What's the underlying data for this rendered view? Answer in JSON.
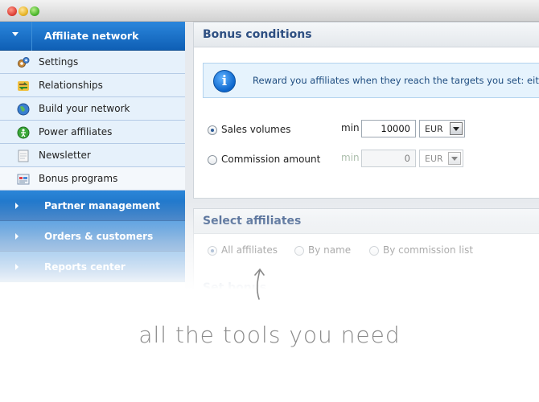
{
  "sidebar": {
    "header": {
      "label": "Affiliate network"
    },
    "items": [
      {
        "label": "Settings",
        "icon": "settings-icon"
      },
      {
        "label": "Relationships",
        "icon": "relationships-icon"
      },
      {
        "label": "Build your network",
        "icon": "globe-icon"
      },
      {
        "label": "Power affiliates",
        "icon": "power-affiliate-icon"
      },
      {
        "label": "Newsletter",
        "icon": "newsletter-icon"
      },
      {
        "label": "Bonus programs",
        "icon": "bonus-programs-icon",
        "active": true
      }
    ],
    "sections": [
      {
        "label": "Partner management"
      },
      {
        "label": "Orders & customers"
      },
      {
        "label": "Reports center"
      }
    ]
  },
  "bonus_conditions": {
    "title": "Bonus conditions",
    "info": "Reward you affiliates when they reach the targets you set: eith",
    "options": [
      {
        "label": "Sales volumes",
        "min_label": "min",
        "value": "10000",
        "currency": "EUR",
        "selected": true
      },
      {
        "label": "Commission amount",
        "min_label": "min",
        "value": "0",
        "currency": "EUR",
        "selected": false
      }
    ]
  },
  "select_affiliates": {
    "title": "Select affiliates",
    "options": [
      "All affiliates",
      "By name",
      "By commission list"
    ]
  },
  "set_bonus": {
    "title": "Set bonus"
  },
  "caption": "all the tools you need",
  "colors": {
    "accent": "#1565c0",
    "panel_title": "#2e4f82",
    "info_bg": "#e6f3fd"
  }
}
